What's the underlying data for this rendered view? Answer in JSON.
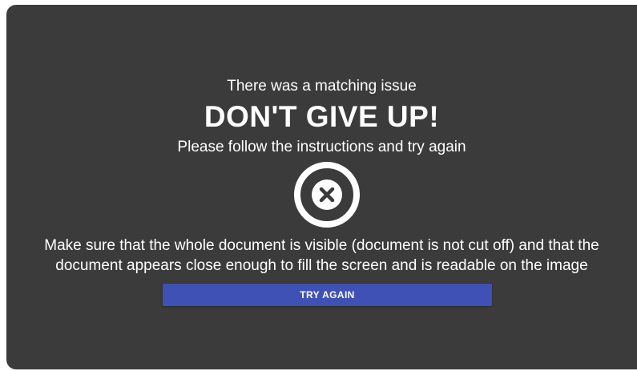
{
  "dialog": {
    "subtitle": "There was a matching issue",
    "headline": "DON'T GIVE UP!",
    "instructions": "Please follow the instructions and try again",
    "icon": "error-circle-x-icon",
    "hint_line1": "Make sure that the whole document is visible (document is not cut off) and that the",
    "hint_line2": "document appears close enough to fill the screen and is readable on the image",
    "button_label": "TRY AGAIN"
  },
  "colors": {
    "panel_background": "#3b3b3b",
    "text": "#ffffff",
    "button_background": "#3f51b5"
  }
}
